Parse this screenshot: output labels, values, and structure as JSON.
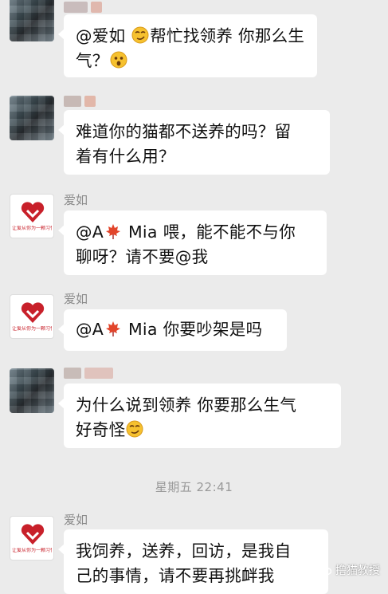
{
  "messages": [
    {
      "sender": "",
      "avatar": "blurred-avatar",
      "segments": [
        "@爱如 ",
        "帮忙找领养 你那么生",
        "气？"
      ]
    },
    {
      "sender": "",
      "avatar": "blurred-avatar",
      "lines": [
        "难道你的猫都不送养的吗？留",
        "着有什么用？"
      ]
    },
    {
      "sender": "爱如",
      "avatar": "heart-logo",
      "logo_text": "让爱从你为一颗习惯",
      "segments": [
        "@A",
        " Mia 喂，能不能不与你",
        "聊呀？请不要@我"
      ]
    },
    {
      "sender": "爱如",
      "avatar": "heart-logo",
      "logo_text": "让爱从你为一颗习惯",
      "segments": [
        "@A",
        " Mia 你要吵架是吗"
      ]
    },
    {
      "sender": "",
      "avatar": "blurred-avatar",
      "segments": [
        "为什么说到领养 你要那么生气",
        "好奇怪"
      ]
    },
    {
      "sender": "爱如",
      "avatar": "heart-logo",
      "logo_text": "让爱从你为一颗习惯",
      "lines": [
        "我饲养，送养，回访，是我自",
        "己的事情，请不要再挑衅我"
      ]
    }
  ],
  "time_divider": "星期五 22:41",
  "watermark": "撸猫教授",
  "colors": {
    "background": "#ebebeb",
    "bubble": "#ffffff",
    "brand_red": "#c8202a",
    "name_gray": "#8a8a8a"
  }
}
